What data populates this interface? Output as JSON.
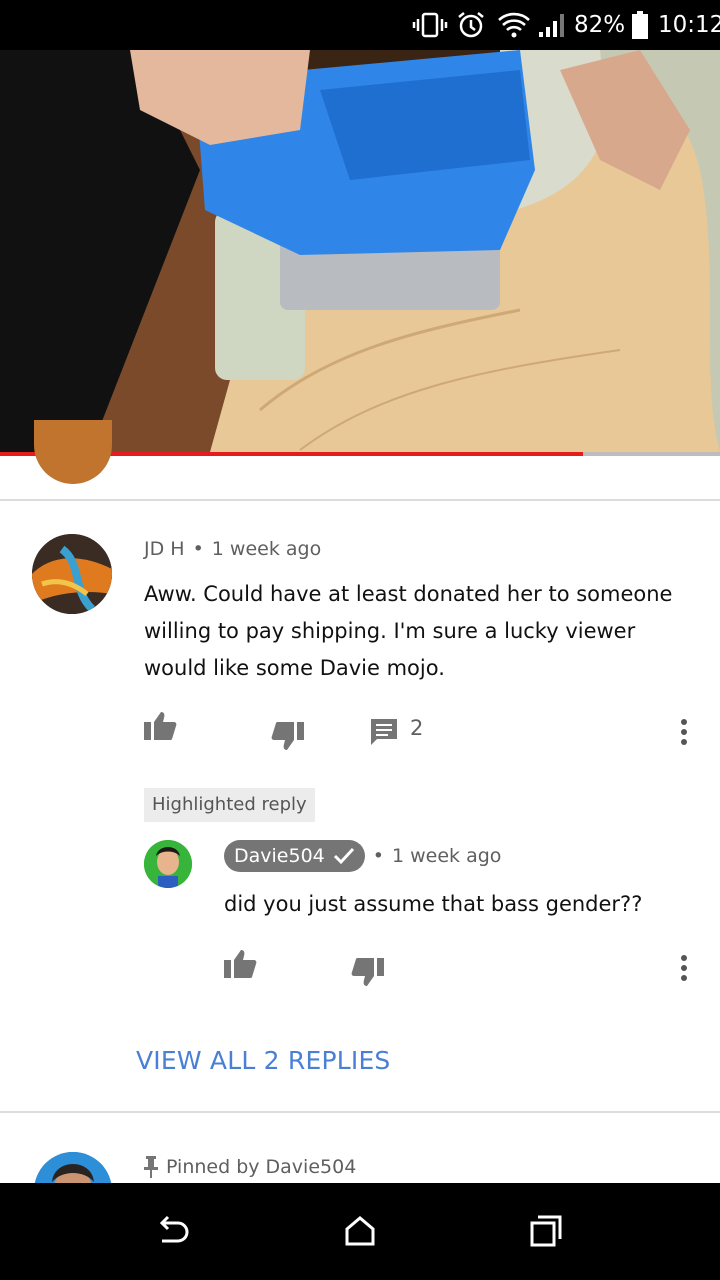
{
  "status_bar": {
    "battery_percent": "82%",
    "time": "10:12",
    "icons": [
      "vibrate-icon",
      "alarm-icon",
      "wifi-icon",
      "signal-icon",
      "battery-icon"
    ]
  },
  "video": {
    "progress": 0.81,
    "colors": {
      "progress_played": "#e51c1c",
      "progress_track": "#bdbdbd"
    }
  },
  "comment": {
    "author": "JD H",
    "separator": "•",
    "time": "1 week ago",
    "text": "Aww. Could have at least donated her to someone willing to pay shipping. I'm sure a lucky viewer would like some Davie mojo.",
    "reply_count": "2"
  },
  "reply": {
    "highlight_label": "Highlighted reply",
    "author": "Davie504",
    "separator": "•",
    "time": "1 week ago",
    "text": "did you just assume that bass gender??"
  },
  "view_all_label": "VIEW ALL 2 REPLIES",
  "next_comment": {
    "pinned_label": "Pinned by Davie504"
  },
  "nav": {
    "icons": [
      "back-icon",
      "home-icon",
      "recents-icon"
    ]
  },
  "accent_colors": {
    "link": "#4a7fd6",
    "icon_gray": "#757575"
  }
}
